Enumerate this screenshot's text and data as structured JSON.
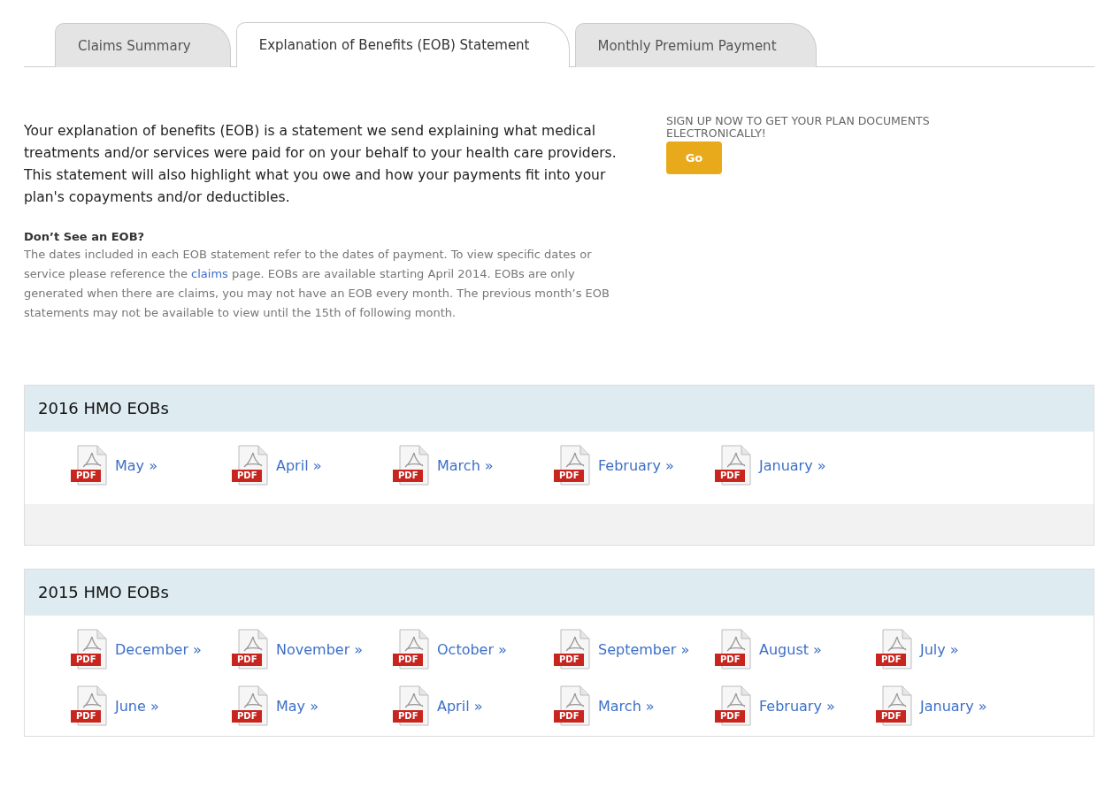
{
  "tabs": [
    {
      "label": "Claims Summary",
      "selected": false
    },
    {
      "label": "Explanation of Benefits (EOB) Statement",
      "selected": true
    },
    {
      "label": "Monthly Premium Payment",
      "selected": false
    }
  ],
  "intro": "Your explanation of benefits (EOB) is a statement we send explaining what medical treatments and/or services were paid for on your behalf to your health care providers. This statement will also highlight what you owe and how your payments fit into your plan's copayments and/or deductibles.",
  "note": {
    "title": "Don’t See an EOB?",
    "parts": [
      {
        "kind": "text",
        "text": "The dates included in each EOB statement refer to the dates of payment. To view specific dates or service please reference the "
      },
      {
        "kind": "link",
        "text": "claims"
      },
      {
        "kind": "text",
        "text": " page. EOBs are available starting April 2014. EOBs are only generated when there are claims, you may not have an EOB every month. The previous month’s EOB statements may not be available to view until the 15th of following month."
      }
    ]
  },
  "signup": {
    "text": "SIGN UP NOW TO GET YOUR PLAN DOCUMENTS ELECTRONICALLY!",
    "button": "Go"
  },
  "sections": [
    {
      "title": "2016 HMO EOBs",
      "footer": true,
      "links": [
        {
          "label": "May »",
          "icon_text": "PDF"
        },
        {
          "label": "April »",
          "icon_text": "PDF"
        },
        {
          "label": "March »",
          "icon_text": "PDF"
        },
        {
          "label": "February »",
          "icon_text": "PDF"
        },
        {
          "label": "January »",
          "icon_text": "PDF"
        }
      ]
    },
    {
      "title": "2015 HMO EOBs",
      "footer": false,
      "links": [
        {
          "label": "December »",
          "icon_text": "PDF"
        },
        {
          "label": "November »",
          "icon_text": "PDF"
        },
        {
          "label": "October »",
          "icon_text": "PDF"
        },
        {
          "label": "September »",
          "icon_text": "PDF"
        },
        {
          "label": "August »",
          "icon_text": "PDF"
        },
        {
          "label": "July »",
          "icon_text": "PDF"
        },
        {
          "label": "June »",
          "icon_text": "PDF"
        },
        {
          "label": "May »",
          "icon_text": "PDF"
        },
        {
          "label": "April »",
          "icon_text": "PDF"
        },
        {
          "label": "March »",
          "icon_text": "PDF"
        },
        {
          "label": "February »",
          "icon_text": "PDF"
        },
        {
          "label": "January »",
          "icon_text": "PDF"
        }
      ]
    }
  ]
}
